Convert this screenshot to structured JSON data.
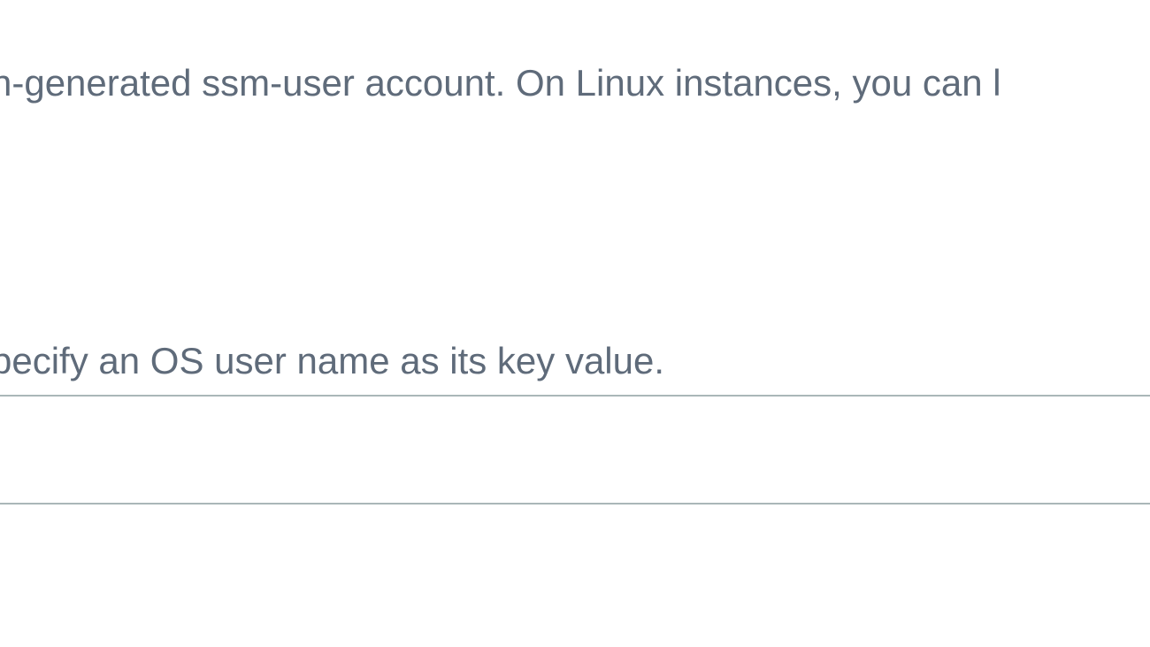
{
  "section": {
    "description_fragment": "n-generated ssm-user account. On Linux instances, you can l",
    "helper_fragment": "pecify an OS user name as its key value.",
    "input_value": ""
  }
}
